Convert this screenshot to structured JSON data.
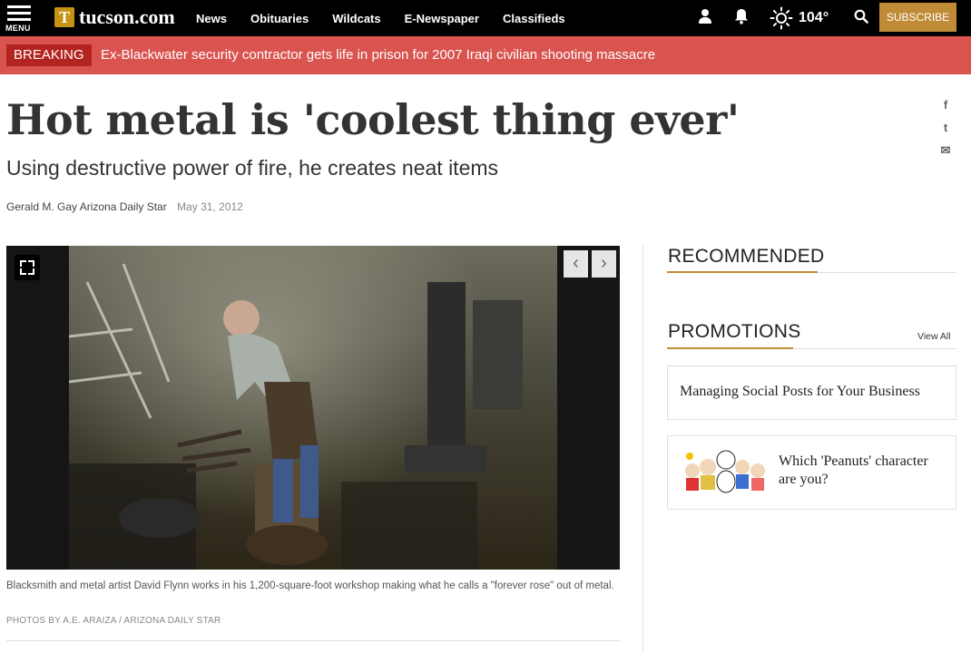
{
  "header": {
    "menu_label": "MENU",
    "logo_mark": "T",
    "logo_text": "tucson.com",
    "nav": [
      "News",
      "Obituaries",
      "Wildcats",
      "E-Newspaper",
      "Classifieds"
    ],
    "temperature": "104°",
    "subscribe_label": "SUBSCRIBE"
  },
  "breaking": {
    "tag": "BREAKING",
    "text": "Ex-Blackwater security contractor gets life in prison for 2007 Iraqi civilian shooting massacre"
  },
  "article": {
    "headline": "Hot metal is 'coolest thing ever'",
    "subhead": "Using destructive power of fire, he creates neat items",
    "author": "Gerald M. Gay Arizona Daily Star",
    "date": "May 31, 2012",
    "caption": "Blacksmith and metal artist David Flynn works in his 1,200-square-foot workshop making what he calls a \"forever rose\" out of metal.",
    "credit": "PHOTOS BY A.E. ARAIZA / ARIZONA DAILY STAR"
  },
  "share": {
    "facebook": "f",
    "twitter": "t",
    "email": "✉"
  },
  "rail": {
    "recommended_heading": "RECOMMENDED",
    "promotions_heading": "PROMOTIONS",
    "view_all": "View All",
    "promos": [
      {
        "title": "Managing Social Posts for Your Business"
      },
      {
        "title": "Which 'Peanuts' character are you?"
      }
    ]
  },
  "colors": {
    "breaking_bar": "#d9534f",
    "accent": "#c08b36",
    "nav_bg": "#000000"
  }
}
